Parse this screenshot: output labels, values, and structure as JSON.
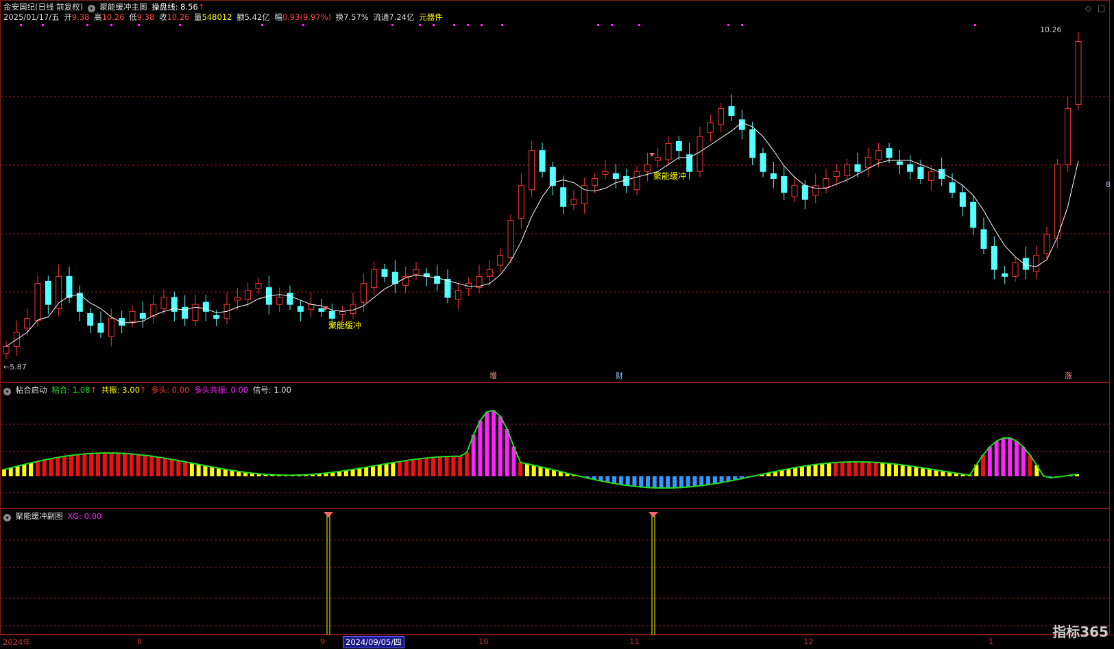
{
  "header": {
    "stock": "金安国纪(日线 前复权)",
    "indicator": "聚能缓冲主图",
    "line_label": "操盘线: 8.56",
    "line_arrow": "↑",
    "date": "2025/01/17/五",
    "open_label": "开",
    "open": "9.38",
    "high_label": "高",
    "high": "10.26",
    "low_label": "低",
    "low": "9.38",
    "close_label": "收",
    "close": "10.26",
    "vol_label": "量",
    "vol": "548012",
    "amount": "额5.42亿",
    "change_label": "幅",
    "change": "0.93(9.97%)",
    "turnover": "换7.57%",
    "float": "流通7.24亿",
    "sector": "元器件"
  },
  "main_chart": {
    "price_high_label": "10.26",
    "price_low_label": "5.87",
    "signal_label_1": "聚能缓冲",
    "signal_label_2": "聚能缓冲",
    "event_1": "增",
    "event_2": "财",
    "event_3": "涨",
    "right_value": "8"
  },
  "indicator1": {
    "name": "粘合启动",
    "f1_label": "粘合: ",
    "f1_value": "1.08",
    "f2_label": "共振: ",
    "f2_value": "3.00",
    "f3_label": "多头: ",
    "f3_value": "0.00",
    "f4_label": "多头共振: ",
    "f4_value": "0.00",
    "f5_label": "信号: ",
    "f5_value": "1.00",
    "arrow": "↑"
  },
  "indicator2": {
    "name": "聚能缓冲副图",
    "xg_label": "XG: ",
    "xg_value": "0.00"
  },
  "axis": {
    "labels": [
      "2024年",
      "8",
      "9",
      "10",
      "11",
      "12",
      "1"
    ],
    "cursor_date": "2024/09/05/四"
  },
  "logo": "指标365",
  "colors": {
    "up": "#ff3333",
    "down": "#54ffff",
    "ma": "#ffffff",
    "grid": "#8a1a1a",
    "osc": "#22dd22",
    "magenta": "#ff22ff",
    "yellow": "#ffff00",
    "blue": "#3399ff"
  },
  "chart_data": {
    "type": "candlestick",
    "title": "金安国纪(日线 前复权)",
    "ohlc_scale_range": [
      5.87,
      10.26
    ],
    "last_close": 10.26,
    "ma_label": "操盘线",
    "ma_last": 8.56,
    "candles_approx_close": [
      5.9,
      6.1,
      6.3,
      6.8,
      6.5,
      6.9,
      6.6,
      6.4,
      6.2,
      6.1,
      6.3,
      6.2,
      6.4,
      6.3,
      6.5,
      6.6,
      6.4,
      6.3,
      6.5,
      6.4,
      6.3,
      6.5,
      6.6,
      6.7,
      6.8,
      6.5,
      6.6,
      6.5,
      6.4,
      6.5,
      6.4,
      6.3,
      6.4,
      6.5,
      6.8,
      7.0,
      6.9,
      6.8,
      6.9,
      7.0,
      6.9,
      6.8,
      6.6,
      6.7,
      6.8,
      6.9,
      7.0,
      7.2,
      7.7,
      8.2,
      8.7,
      8.4,
      8.2,
      7.9,
      8.0,
      8.2,
      8.3,
      8.4,
      8.3,
      8.2,
      8.4,
      8.5,
      8.6,
      8.8,
      8.7,
      8.4,
      8.9,
      9.1,
      9.3,
      9.2,
      9.0,
      8.6,
      8.4,
      8.3,
      8.1,
      8.2,
      8.0,
      8.2,
      8.3,
      8.4,
      8.5,
      8.4,
      8.6,
      8.7,
      8.6,
      8.5,
      8.4,
      8.3,
      8.4,
      8.3,
      8.1,
      7.9,
      7.6,
      7.3,
      7.0,
      6.9,
      7.1,
      7.0,
      7.2,
      7.5,
      8.5,
      9.3,
      10.26
    ]
  }
}
